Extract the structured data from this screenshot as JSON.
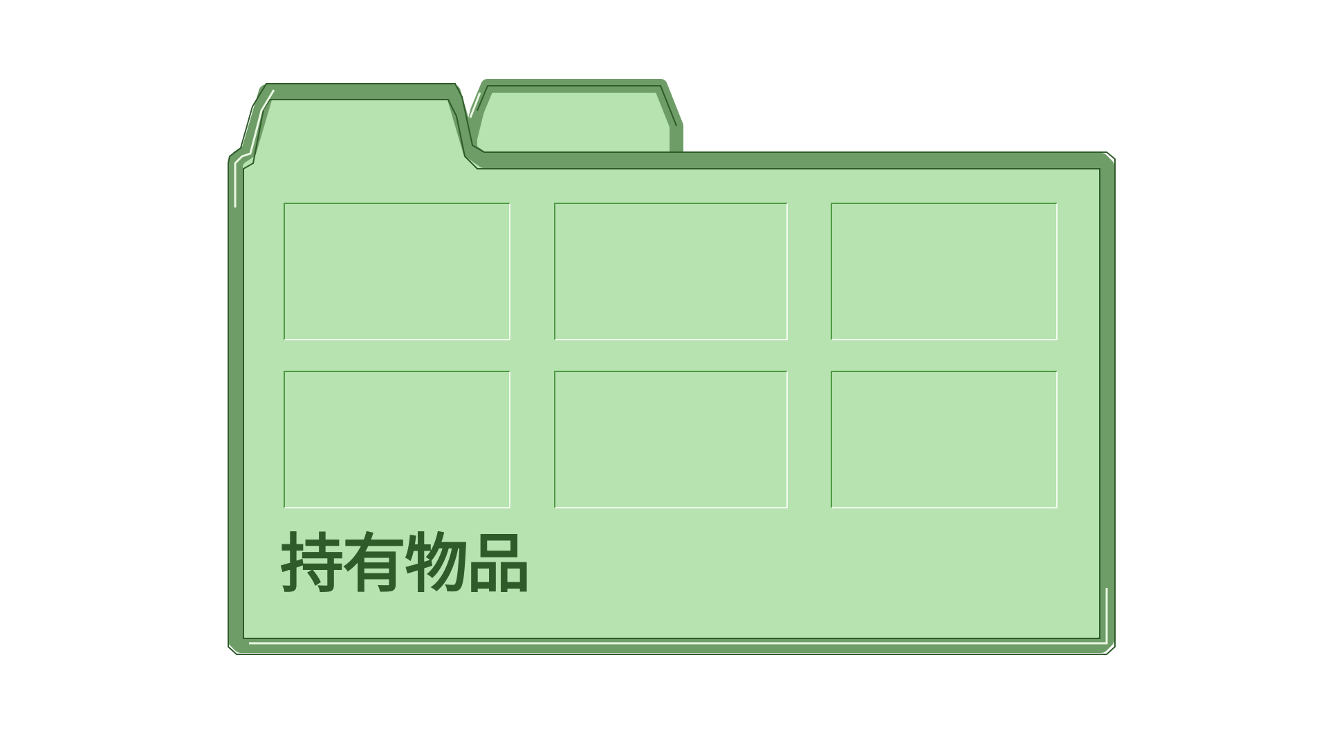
{
  "panel": {
    "title": "持有物品",
    "slot_count": 6
  },
  "colors": {
    "background": "#ffffff",
    "panel_fill": "#b6e3b0",
    "frame": "#6e9d67",
    "frame_dark": "#2f5b2a",
    "frame_highlight": "#e8f7e2",
    "slot_shadow": "#4f9a44",
    "slot_highlight": "#f4fbef",
    "title_text": "#2f5b2a"
  }
}
